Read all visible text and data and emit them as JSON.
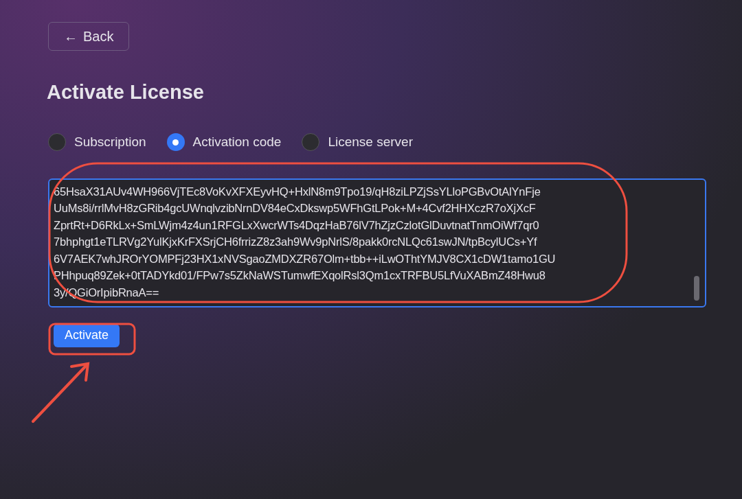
{
  "back_button": {
    "icon": "←",
    "label": "Back"
  },
  "title": "Activate License",
  "license_types": [
    {
      "label": "Subscription",
      "selected": false
    },
    {
      "label": "Activation code",
      "selected": true
    },
    {
      "label": "License server",
      "selected": false
    }
  ],
  "activation_code": {
    "lines": [
      "65HsaX31AUv4WH966VjTEc8VoKvXFXEyvHQ+HxlN8m9Tpo19/qH8ziLPZjSsYLloPGBvOtAlYnFje",
      "UuMs8i/rrlMvH8zGRib4gcUWnqlvzibNrnDV84eCxDkswp5WFhGtLPok+M+4Cvf2HHXczR7oXjXcF",
      "ZprtRt+D6RkLx+SmLWjm4z4un1RFGLxXwcrWTs4DqzHaB76lV7hZjzCzlotGlDuvtnatTnmOiWf7qr0",
      "7bhphgt1eTLRVg2YulKjxKrFXSrjCH6frrizZ8z3ah9Wv9pNrlS/8pakk0rcNLQc61swJN/tpBcylUCs+Yf",
      "6V7AEK7whJROrYOMPFj23HX1xNVSgaoZMDXZR67Olm+tbb++iLwOThtYMJV8CX1cDW1tamo1GU",
      "PHhpuq89Zek+0tTADYkd01/FPw7s5ZkNaWSTumwfEXqolRsl3Qm1cxTRFBU5LfVuXABmZ48Hwu8",
      "3y/QGiOrIpibRnaA=="
    ]
  },
  "activate_button": {
    "label": "Activate"
  }
}
